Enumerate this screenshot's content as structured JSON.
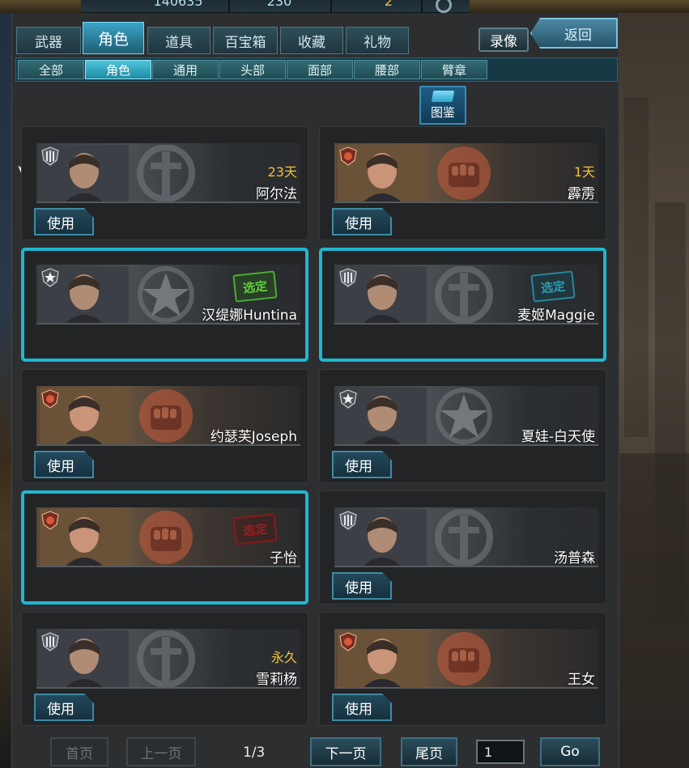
{
  "topbar": {
    "stat1": "140635",
    "stat2": "230",
    "stat3": "2"
  },
  "tabs": [
    "武器",
    "角色",
    "道具",
    "百宝箱",
    "收藏",
    "礼物"
  ],
  "active_tab": "角色",
  "buttons": {
    "record": "录像",
    "back": "返回",
    "guide": "图鉴"
  },
  "subtabs": [
    "全部",
    "角色",
    "通用",
    "头部",
    "面部",
    "腰部",
    "臂章"
  ],
  "active_subtab": "角色",
  "cards": [
    {
      "name": "阿尔法",
      "days": "23天",
      "theme": "gray",
      "rank": "armory",
      "selected": false,
      "stamp": "",
      "use": "使用"
    },
    {
      "name": "霹雳",
      "days": "1天",
      "theme": "red",
      "rank": "fist",
      "selected": false,
      "stamp": "",
      "use": "使用"
    },
    {
      "name": "汉缇娜Huntina",
      "days": "",
      "theme": "gray",
      "rank": "star",
      "selected": true,
      "stamp": "选定",
      "use": ""
    },
    {
      "name": "麦姬Maggie",
      "days": "",
      "theme": "gray",
      "rank": "armory",
      "selected": true,
      "stamp": "选定",
      "use": ""
    },
    {
      "name": "约瑟芙Joseph",
      "days": "",
      "theme": "red",
      "rank": "fist",
      "selected": false,
      "stamp": "",
      "use": "使用"
    },
    {
      "name": "夏娃-白天使",
      "days": "",
      "theme": "gray",
      "rank": "star",
      "selected": false,
      "stamp": "",
      "use": "使用"
    },
    {
      "name": "子怡",
      "days": "",
      "theme": "red",
      "rank": "fist",
      "selected": true,
      "stamp": "选定",
      "use": ""
    },
    {
      "name": "汤普森",
      "days": "",
      "theme": "gray",
      "rank": "armory",
      "selected": false,
      "stamp": "",
      "use": "使用"
    },
    {
      "name": "雪莉杨",
      "days": "永久",
      "theme": "gray",
      "rank": "armory",
      "selected": false,
      "stamp": "",
      "use": "使用"
    },
    {
      "name": "王女",
      "days": "",
      "theme": "red",
      "rank": "fist",
      "selected": false,
      "stamp": "",
      "use": "使用"
    }
  ],
  "pagination": {
    "first": "首页",
    "prev": "上一页",
    "page": "1/3",
    "next": "下一页",
    "last": "尾页",
    "input_value": "1",
    "go": "Go"
  },
  "colors": {
    "accent": "#1fb7d0",
    "gold": "#f0c33a",
    "stamp_green": "#5ecf3f",
    "stamp_teal": "#2b9bb0",
    "stamp_red": "#9a1e1e"
  }
}
